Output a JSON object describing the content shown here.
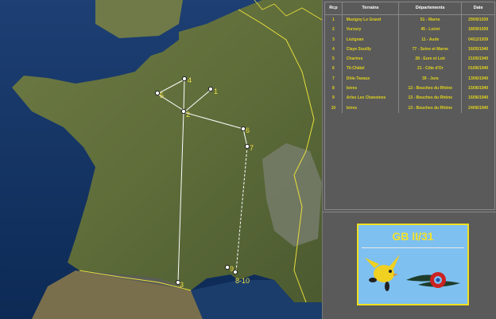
{
  "table": {
    "headers": {
      "col1": "Rcp",
      "col2": "Terrains",
      "col3": "Départements",
      "col4": "Date"
    },
    "rows": [
      {
        "n": "1",
        "terrain": "Muzigny Le Grand",
        "dept": "51 - Marne",
        "date": "29/09/1939"
      },
      {
        "n": "2",
        "terrain": "Vurzury",
        "dept": "45 - Loiret",
        "date": "18/09/1939"
      },
      {
        "n": "3",
        "terrain": "Lézignan",
        "dept": "11 - Aude",
        "date": "04/12/1939"
      },
      {
        "n": "4",
        "terrain": "Claye Souilly",
        "dept": "77 - Seine et Marne",
        "date": "16/05/1940"
      },
      {
        "n": "5",
        "terrain": "Chartres",
        "dept": "28 - Eure et Loir",
        "date": "21/05/1940"
      },
      {
        "n": "6",
        "terrain": "Til-Châtel",
        "dept": "21 - Côte d'Or",
        "date": "01/06/1940"
      },
      {
        "n": "7",
        "terrain": "Dôle-Tavaux",
        "dept": "39 - Jura",
        "date": "13/06/1940"
      },
      {
        "n": "8",
        "terrain": "Istres",
        "dept": "13 - Bouches du Rhône",
        "date": "15/06/1940"
      },
      {
        "n": "9",
        "terrain": "Arles Les Chanoines",
        "dept": "13 - Bouches du Rhône",
        "date": "16/06/1940"
      },
      {
        "n": "10",
        "terrain": "Istres",
        "dept": "13 - Bouches du Rhône",
        "date": "24/06/1940"
      }
    ]
  },
  "badge": {
    "title": "GB II/31"
  },
  "map": {
    "markers": [
      "1",
      "2",
      "3",
      "4",
      "5",
      "6",
      "7",
      "9",
      "8-10"
    ]
  },
  "colors": {
    "row_text": "#e0d21b",
    "route": "#ffffff",
    "marker_label": "#f0e040",
    "border": "#f0e020"
  }
}
